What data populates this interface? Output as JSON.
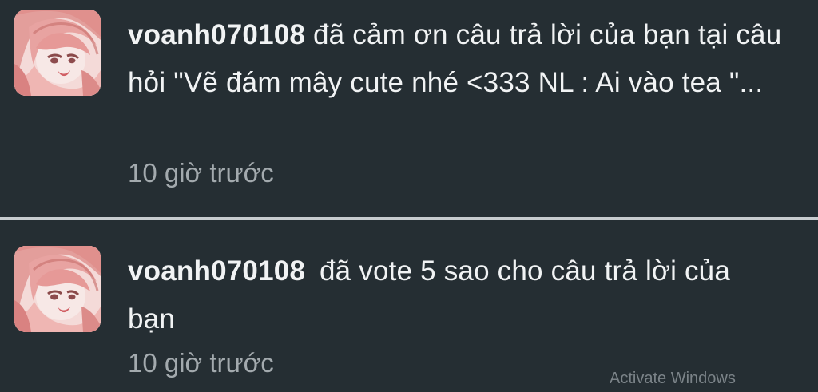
{
  "notifications": [
    {
      "username": "voanh070108",
      "message": "đã cảm ơn câu trả lời của bạn tại câu hỏi \"Vẽ đám mây cute nhé <333 NL : Ai vào tea \"...",
      "time": "10 giờ trước",
      "avatar_icon": "anime-girl-avatar"
    },
    {
      "username": "voanh070108",
      "message": "đã vote 5 sao cho câu trả lời của bạn",
      "time": "10 giờ trước",
      "avatar_icon": "anime-girl-avatar"
    }
  ],
  "watermark": "Activate Windows",
  "colors": {
    "background": "#252e33",
    "text": "#f1f3f4",
    "muted_text": "#a3aaae",
    "divider": "#c7cccf"
  }
}
